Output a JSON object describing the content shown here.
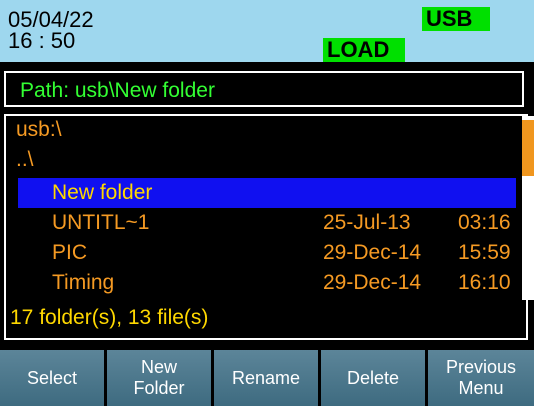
{
  "header": {
    "date": "05/04/22",
    "time": "16 : 50",
    "usb_badge": "USB",
    "load_badge": "LOAD"
  },
  "path": "Path: usb\\New folder",
  "browser": {
    "root": "usb:\\",
    "up": "..\\",
    "rows": [
      {
        "name": "New folder",
        "date": "",
        "time": "",
        "selected": true
      },
      {
        "name": "UNTITL~1",
        "date": "25-Jul-13",
        "time": "03:16"
      },
      {
        "name": "PIC",
        "date": "29-Dec-14",
        "time": "15:59"
      },
      {
        "name": "Timing",
        "date": "29-Dec-14",
        "time": "16:10"
      }
    ],
    "summary": "17 folder(s), 13 file(s)"
  },
  "softkeys": [
    {
      "line1": "Select",
      "line2": ""
    },
    {
      "line1": "New",
      "line2": "Folder"
    },
    {
      "line1": "Rename",
      "line2": ""
    },
    {
      "line1": "Delete",
      "line2": ""
    },
    {
      "line1": "Previous",
      "line2": "Menu"
    }
  ],
  "colors": {
    "header_bg": "#9ED7EE",
    "badge_green": "#00E000",
    "path_green": "#33FF33",
    "file_orange": "#F59A23",
    "selected_blue": "#1010F0",
    "selected_text": "#FFD800"
  }
}
